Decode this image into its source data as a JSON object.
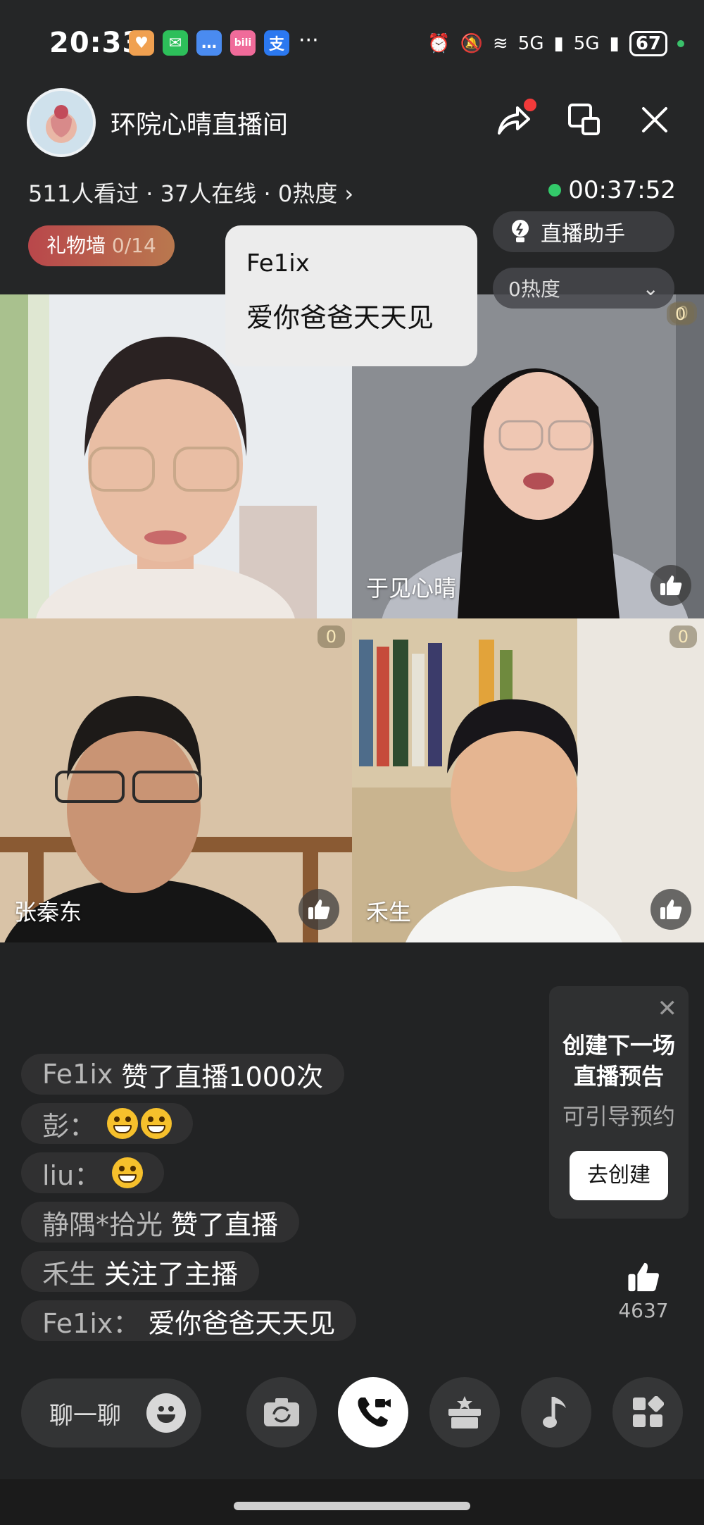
{
  "status_bar": {
    "time": "20:33",
    "apps": [
      {
        "icon": "heart-app-icon",
        "glyph": "♥",
        "color": "#f0a050"
      },
      {
        "icon": "wechat-icon",
        "glyph": "✉",
        "color": "#2dbf5a"
      },
      {
        "icon": "messages-icon",
        "glyph": "…",
        "color": "#4a8bf0"
      },
      {
        "icon": "bilibili-icon",
        "glyph": "b",
        "color": "#f06b9a"
      },
      {
        "icon": "alipay-icon",
        "glyph": "支",
        "color": "#2b78f0"
      }
    ],
    "more": "···",
    "network_1": "5G",
    "network_2": "5G",
    "battery": "67"
  },
  "header": {
    "room_title": "环院心晴直播间",
    "stats": "511人看过 · 37人在线 · 0热度 ›",
    "timer": "00:37:52",
    "gift_wall_label": "礼物墙",
    "gift_wall_count": "0",
    "gift_wall_total": "/14",
    "assistant_label": "直播助手",
    "heat_dropdown": "0热度"
  },
  "bubble": {
    "name": "Fe1ix",
    "message": "爱你爸爸天天见"
  },
  "tiles": [
    {
      "label": "",
      "count": ""
    },
    {
      "label": "于见心晴",
      "count": "0"
    },
    {
      "label": "张秦东",
      "count": "0"
    },
    {
      "label": "禾生",
      "count": "0"
    }
  ],
  "chat": [
    {
      "user": "Fe1ix",
      "text": "赞了直播1000次"
    },
    {
      "user": "彭：",
      "text": "",
      "emojis": 2
    },
    {
      "user": "liu：",
      "text": "",
      "emojis": 1
    },
    {
      "user": "静隅*拾光",
      "text": "赞了直播"
    },
    {
      "user": "禾生",
      "text": "关注了主播"
    },
    {
      "user": "Fe1ix：",
      "text": "爱你爸爸天天见"
    }
  ],
  "promo": {
    "title_line1": "创建下一场",
    "title_line2": "直播预告",
    "subtitle": "可引导预约",
    "button": "去创建"
  },
  "likes": {
    "count": "4637"
  },
  "toolbar": {
    "chat_placeholder": "聊一聊"
  },
  "colors": {
    "live_green": "#33c96a",
    "gift_wall_from": "#b9474b",
    "gift_wall_to": "#b9784e"
  }
}
